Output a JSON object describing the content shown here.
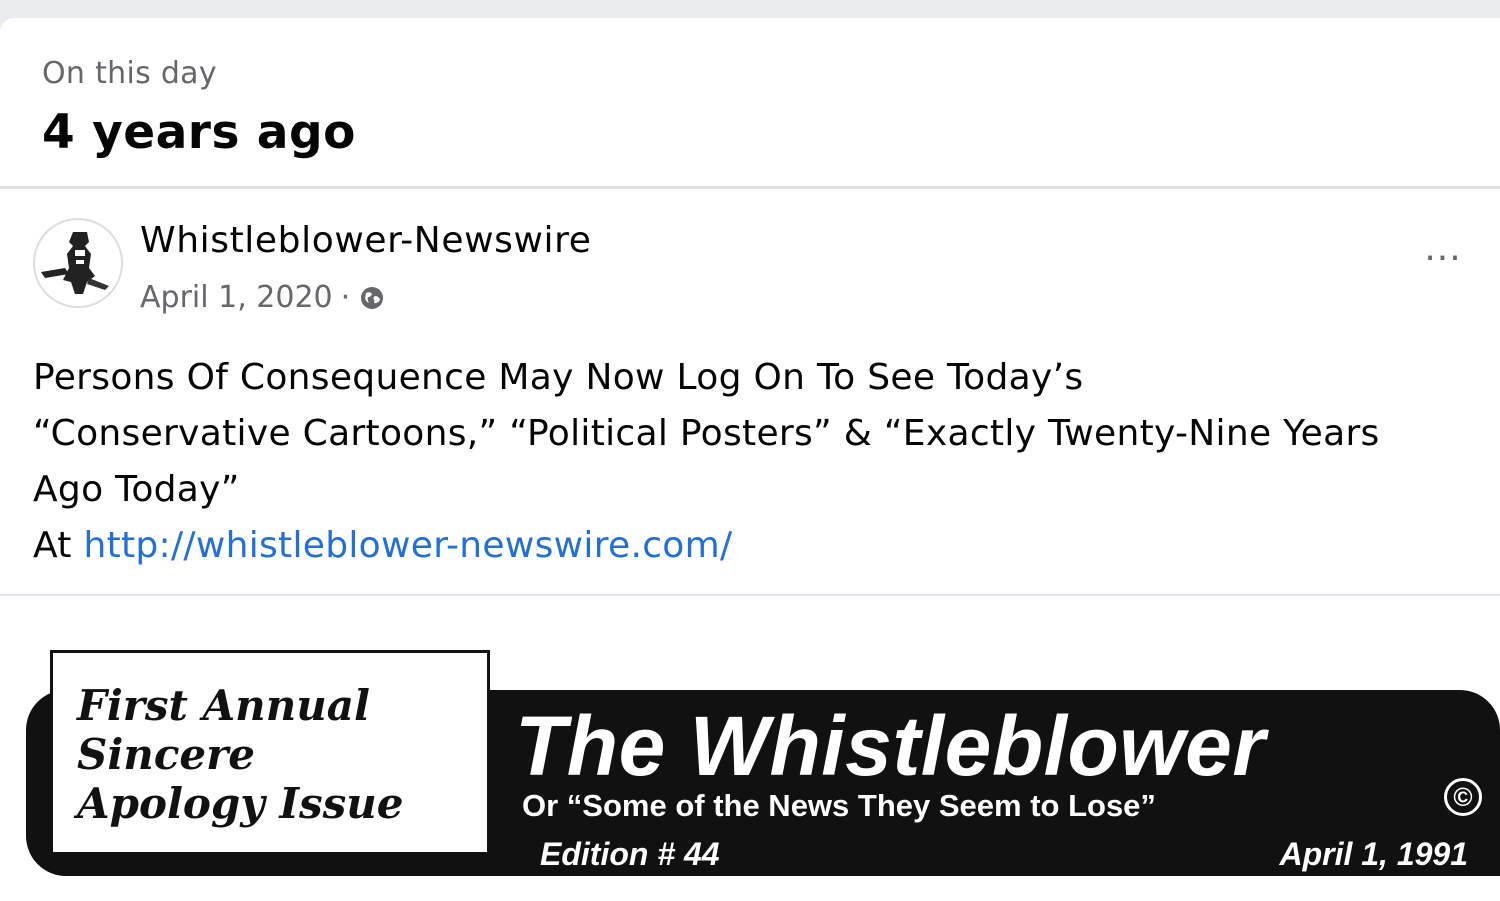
{
  "memory": {
    "subtitle": "On this day",
    "title": "4 years ago"
  },
  "post": {
    "page_name": "Whistleblower-Newswire",
    "date": "April 1, 2020",
    "separator": "·",
    "privacy_icon": "globe-icon",
    "more_label": "···",
    "body_lines": [
      "Persons Of Consequence May Now Log On To See Today’s",
      "“Conservative Cartoons,” “Political Posters” & “Exactly Twenty-Nine Years",
      "Ago Today”"
    ],
    "link_prefix": "At ",
    "link_text": "http://whistleblower-newswire.com/"
  },
  "banner": {
    "apology_lines": [
      "First Annual",
      "Sincere",
      "Apology Issue"
    ],
    "masthead_title": "The Whistleblower",
    "masthead_subtitle": "Or “Some of the News They Seem to Lose”",
    "edition": "Edition # 44",
    "date": "April 1, 1991",
    "copyright_symbol": "©"
  }
}
